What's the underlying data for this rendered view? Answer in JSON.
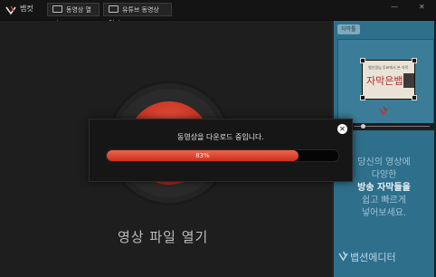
{
  "app": {
    "title": "뱁컷"
  },
  "toolbar": {
    "open_video_label": "동영상 열기",
    "open_youtube_label": "유튜브 동영상 열기"
  },
  "window": {
    "minimize_glyph": "—",
    "close_glyph": "✕"
  },
  "main": {
    "open_file_label": "영상 파일 열기"
  },
  "side_panel": {
    "tab_label": "자막툴",
    "poster_small_text": "뱁선생님 투표에서 본 자막",
    "poster_main_text": "자막은뱁",
    "promo_lines": [
      "당신의 영상에",
      "다양한",
      "방송 자막들을",
      "쉽고 빠르게",
      "넣어보세요."
    ],
    "brand": "뱁션에디터"
  },
  "modal": {
    "message": "동영상을 다운로드 중입니다.",
    "progress": 0.83,
    "progress_label": "83%",
    "close_glyph": "✕"
  },
  "colors": {
    "accent": "#d93a26",
    "panel": "#2e6f8c"
  }
}
